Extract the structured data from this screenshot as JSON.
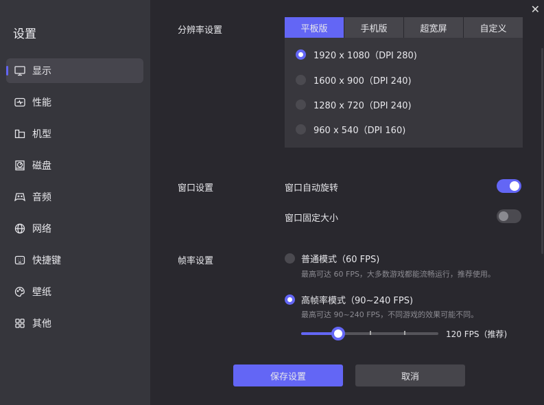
{
  "sidebar": {
    "title": "设置",
    "items": [
      {
        "label": "显示",
        "icon": "monitor-icon"
      },
      {
        "label": "性能",
        "icon": "performance-icon"
      },
      {
        "label": "机型",
        "icon": "folder-icon"
      },
      {
        "label": "磁盘",
        "icon": "disk-icon"
      },
      {
        "label": "音频",
        "icon": "gamepad-icon"
      },
      {
        "label": "网络",
        "icon": "globe-icon"
      },
      {
        "label": "快捷键",
        "icon": "keyboard-icon"
      },
      {
        "label": "壁纸",
        "icon": "palette-icon"
      },
      {
        "label": "其他",
        "icon": "grid-icon"
      }
    ]
  },
  "resolution": {
    "label": "分辨率设置",
    "tabs": [
      "平板版",
      "手机版",
      "超宽屏",
      "自定义"
    ],
    "active_tab": 0,
    "options": [
      "1920 x 1080（DPI 280)",
      "1600 x 900（DPI 240)",
      "1280 x 720（DPI 240)",
      "960 x 540（DPI 160)"
    ],
    "selected": 0
  },
  "window": {
    "label": "窗口设置",
    "auto_rotate": "窗口自动旋转",
    "auto_rotate_on": true,
    "fixed_size": "窗口固定大小",
    "fixed_size_on": false
  },
  "framerate": {
    "label": "帧率设置",
    "normal": {
      "title": "普通模式（60 FPS)",
      "desc": "最高可达 60 FPS，大多数游戏都能流畅运行，推荐使用。",
      "selected": false
    },
    "high": {
      "title": "高帧率模式（90~240 FPS)",
      "desc": "最高可达 90~240 FPS，不同游戏的效果可能不同。",
      "selected": true
    },
    "slider_value_label": "120 FPS（推荐)",
    "slider_fraction": 0.27
  },
  "buttons": {
    "save": "保存设置",
    "cancel": "取消"
  },
  "colors": {
    "accent": "#6366f5"
  }
}
